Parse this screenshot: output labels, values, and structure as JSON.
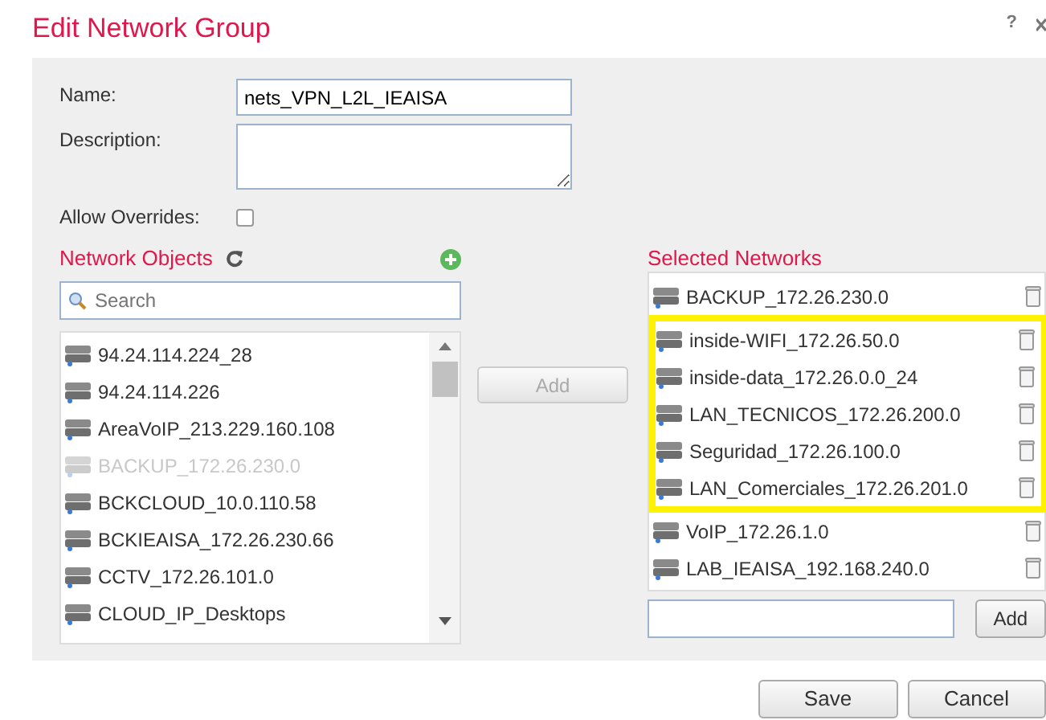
{
  "window": {
    "title": "Edit Network Group",
    "help": "?"
  },
  "form": {
    "name_label": "Name:",
    "name_value": "nets_VPN_L2L_IEAISA",
    "description_label": "Description:",
    "allow_overrides_label": "Allow Overrides:",
    "allow_overrides_checked": false
  },
  "network_objects": {
    "title": "Network Objects",
    "search_placeholder": "Search",
    "items": [
      {
        "label": "94.24.114.224_28",
        "disabled": false
      },
      {
        "label": "94.24.114.226",
        "disabled": false
      },
      {
        "label": "AreaVoIP_213.229.160.108",
        "disabled": false
      },
      {
        "label": "BACKUP_172.26.230.0",
        "disabled": true
      },
      {
        "label": "BCKCLOUD_10.0.110.58",
        "disabled": false
      },
      {
        "label": "BCKIEAISA_172.26.230.66",
        "disabled": false
      },
      {
        "label": "CCTV_172.26.101.0",
        "disabled": false
      },
      {
        "label": "CLOUD_IP_Desktops",
        "disabled": false
      }
    ]
  },
  "add_button": {
    "label": "Add",
    "disabled": true
  },
  "selected_networks": {
    "title": "Selected Networks",
    "items": [
      {
        "label": "BACKUP_172.26.230.0",
        "highlighted": false
      },
      {
        "label": "inside-WIFI_172.26.50.0",
        "highlighted": true
      },
      {
        "label": "inside-data_172.26.0.0_24",
        "highlighted": true
      },
      {
        "label": "LAN_TECNICOS_172.26.200.0",
        "highlighted": true
      },
      {
        "label": "Seguridad_172.26.100.0",
        "highlighted": true
      },
      {
        "label": "LAN_Comerciales_172.26.201.0",
        "highlighted": true
      },
      {
        "label": "VoIP_172.26.1.0",
        "highlighted": false
      },
      {
        "label": "LAB_IEAISA_192.168.240.0",
        "highlighted": false
      }
    ],
    "add_button": "Add"
  },
  "buttons": [
    "Save",
    "Cancel"
  ]
}
